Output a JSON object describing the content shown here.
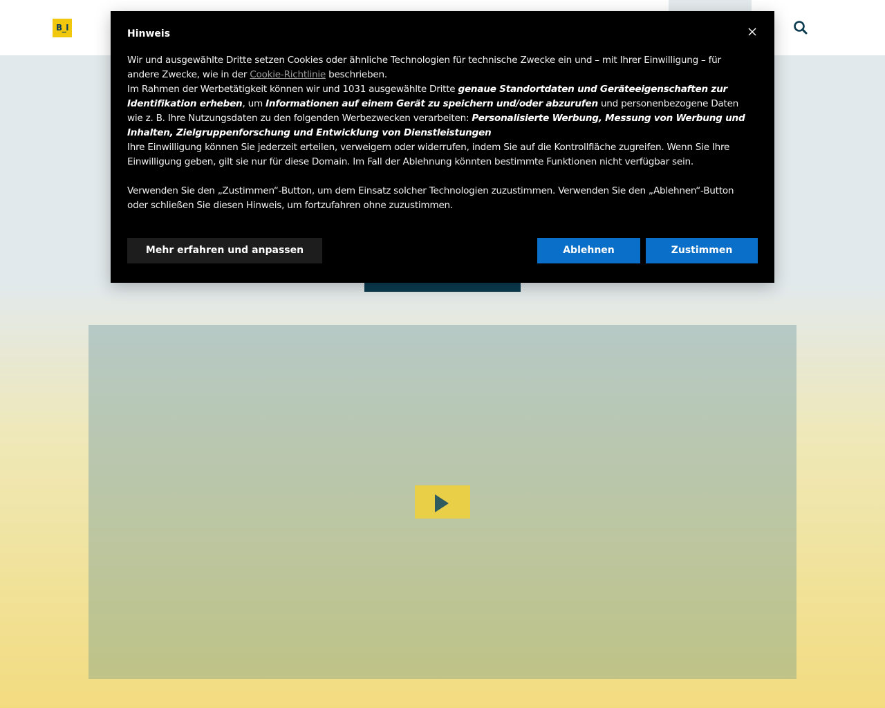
{
  "header": {
    "logo_text": "B_I",
    "search_icon": "search-icon"
  },
  "video": {
    "play_icon": "play-icon"
  },
  "cookie_dialog": {
    "title": "Hinweis",
    "close_icon": "close-icon",
    "p1_a": "Wir und ausgewählte Dritte setzen Cookies oder ähnliche Technologien für technische Zwecke ein und – mit Ihrer Einwilligung – für andere Zwecke, wie in der ",
    "p1_link": "Cookie-Richtlinie",
    "p1_b": " beschrieben.",
    "p2_a": "Im Rahmen der Werbetätigkeit können wir und 1031 ausgewählte Dritte ",
    "p2_b": "genaue Standortdaten und Geräteeigenschaften zur Identifikation erheben",
    "p2_c": ", um ",
    "p2_d": "Informationen auf einem Gerät zu speichern und/oder abzurufen",
    "p2_e": " und personenbezogene Daten wie z. B. Ihre Nutzungsdaten zu den folgenden Werbezwecken verarbeiten: ",
    "p2_f": "Personalisierte Werbung, Messung von Werbung und Inhalten, Zielgruppenforschung und Entwicklung von Dienstleistungen",
    "p3": "Ihre Einwilligung können Sie jederzeit erteilen, verweigern oder widerrufen, indem Sie auf die Kontrollfläche zugreifen. Wenn Sie Ihre Einwilligung geben, gilt sie nur für diese Domain. Im Fall der Ablehnung könnten bestimmte Funktionen nicht verfügbar sein.",
    "p4": "Verwenden Sie den „Zustimmen“-Button, um dem Einsatz solcher Technologien zuzustimmen. Verwenden Sie den „Ablehnen“-Button oder schließen Sie diesen Hinweis, um fortzufahren ohne zuzustimmen.",
    "more_button": "Mehr erfahren und anpassen",
    "reject_button": "Ablehnen",
    "accept_button": "Zustimmen"
  },
  "colors": {
    "brand_yellow": "#f2c80f",
    "brand_dark": "#0b3b50",
    "primary_button": "#0a6fc9"
  }
}
